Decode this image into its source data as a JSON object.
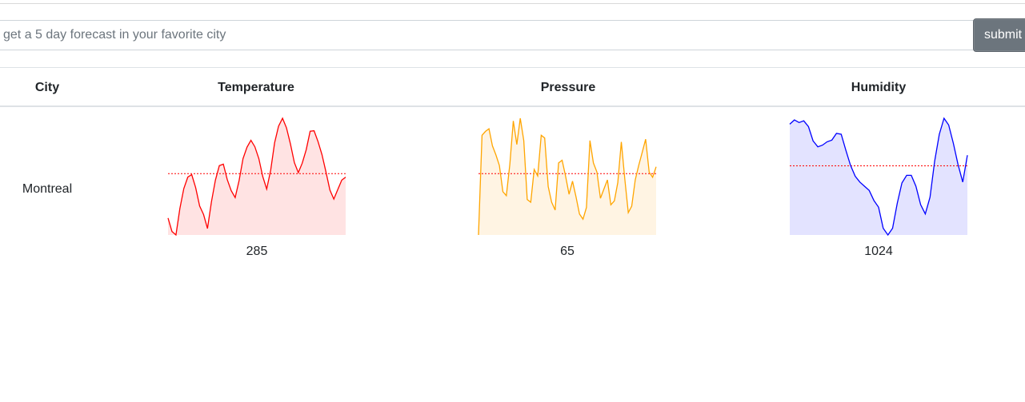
{
  "search": {
    "placeholder": "get a 5 day forecast in your favorite city",
    "value": "",
    "submit_label": "submit"
  },
  "table": {
    "headers": {
      "city": "City",
      "temperature": "Temperature",
      "pressure": "Pressure",
      "humidity": "Humidity"
    },
    "rows": [
      {
        "city": "Montreal",
        "temperature": {
          "average_label": "285",
          "color": "#ff0000",
          "fill": "#ffe3e3",
          "values": [
            64,
            37,
            30,
            83,
            123,
            146,
            151,
            125,
            88,
            71,
            43,
            97,
            140,
            169,
            172,
            141,
            119,
            105,
            139,
            183,
            206,
            220,
            207,
            183,
            147,
            122,
            160,
            215,
            248,
            264,
            245,
            213,
            175,
            155,
            174,
            201,
            238,
            239,
            217,
            191,
            157,
            120,
            102,
            121,
            140,
            146
          ]
        },
        "pressure": {
          "average_label": "65",
          "color": "#ffa500",
          "fill": "#fff4e3",
          "values": [
            60,
            136,
            139,
            141,
            128,
            121,
            113,
            93,
            90,
            114,
            147,
            129,
            149,
            132,
            87,
            85,
            110,
            105,
            136,
            134,
            97,
            85,
            79,
            115,
            117,
            105,
            91,
            101,
            89,
            76,
            72,
            81,
            132,
            115,
            108,
            88,
            95,
            102,
            83,
            86,
            100,
            131,
            103,
            77,
            82,
            102,
            113,
            123,
            133,
            108,
            104,
            112
          ]
        },
        "humidity": {
          "average_label": "1024",
          "color": "#0000ff",
          "fill": "#e3e3ff",
          "values": [
            1025.5,
            1026.0,
            1025.7,
            1025.9,
            1025.2,
            1023.5,
            1022.8,
            1023.0,
            1023.4,
            1023.6,
            1024.4,
            1024.3,
            1022.4,
            1020.6,
            1019.3,
            1018.6,
            1018.1,
            1017.6,
            1016.4,
            1015.6,
            1013.1,
            1012.3,
            1013.1,
            1016.1,
            1018.5,
            1019.4,
            1019.4,
            1018.1,
            1015.9,
            1014.8,
            1016.8,
            1021.1,
            1024.3,
            1026.2,
            1025.4,
            1023.2,
            1020.7,
            1018.6,
            1021.8
          ]
        }
      }
    ]
  }
}
